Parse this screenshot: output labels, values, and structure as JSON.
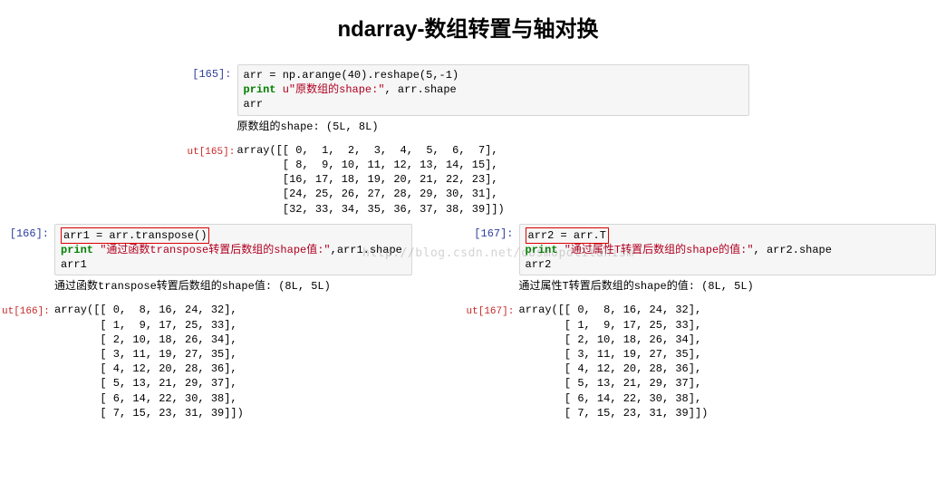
{
  "title": "ndarray-数组转置与轴对换",
  "watermark": "http://blog.csdn.net/cosmopolitanism",
  "top": {
    "in_prompt": "[165]:",
    "code_line1": "arr = np.arange(40).reshape(5,-1)",
    "code_print_kw": "print",
    "code_print_str": " u\"原数组的shape:\"",
    "code_print_tail": ", arr.shape",
    "code_line3": "arr",
    "out_text": "原数组的shape: (5L, 8L)",
    "out_prompt": "ut[165]:",
    "array_out": "array([[ 0,  1,  2,  3,  4,  5,  6,  7],\n       [ 8,  9, 10, 11, 12, 13, 14, 15],\n       [16, 17, 18, 19, 20, 21, 22, 23],\n       [24, 25, 26, 27, 28, 29, 30, 31],\n       [32, 33, 34, 35, 36, 37, 38, 39]])"
  },
  "left": {
    "in_prompt": "[166]:",
    "code_line1": "arr1 = arr.transpose()",
    "code_print_kw": "print",
    "code_print_str": " \"通过函数transpose转置后数组的shape值:\"",
    "code_print_tail": ",arr1.shape",
    "code_line3": "arr1",
    "out_text": "通过函数transpose转置后数组的shape值: (8L, 5L)",
    "out_prompt": "ut[166]:",
    "array_out": "array([[ 0,  8, 16, 24, 32],\n       [ 1,  9, 17, 25, 33],\n       [ 2, 10, 18, 26, 34],\n       [ 3, 11, 19, 27, 35],\n       [ 4, 12, 20, 28, 36],\n       [ 5, 13, 21, 29, 37],\n       [ 6, 14, 22, 30, 38],\n       [ 7, 15, 23, 31, 39]])"
  },
  "right": {
    "in_prompt": "[167]:",
    "code_line1": "arr2 = arr.T",
    "code_print_kw": "print",
    "code_print_str": " \"通过属性T转置后数组的shape的值:\"",
    "code_print_tail": ", arr2.shape",
    "code_line3": "arr2",
    "out_text": "通过属性T转置后数组的shape的值: (8L, 5L)",
    "out_prompt": "ut[167]:",
    "array_out": "array([[ 0,  8, 16, 24, 32],\n       [ 1,  9, 17, 25, 33],\n       [ 2, 10, 18, 26, 34],\n       [ 3, 11, 19, 27, 35],\n       [ 4, 12, 20, 28, 36],\n       [ 5, 13, 21, 29, 37],\n       [ 6, 14, 22, 30, 38],\n       [ 7, 15, 23, 31, 39]])"
  }
}
